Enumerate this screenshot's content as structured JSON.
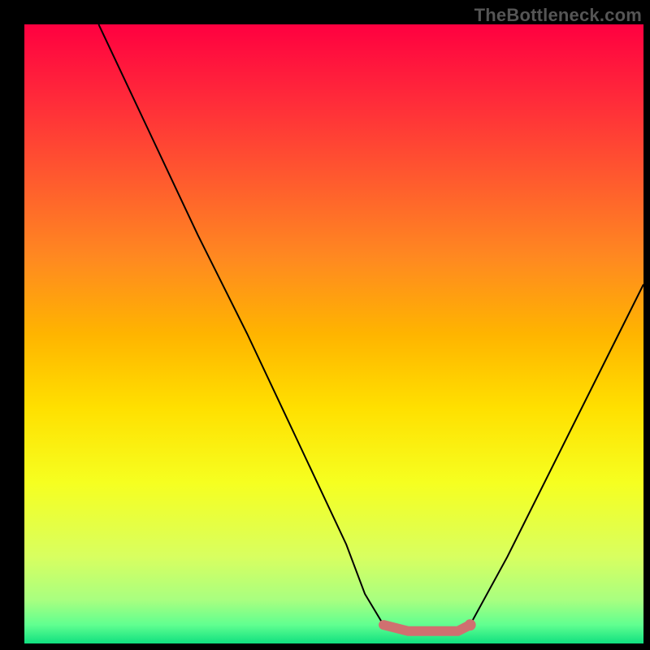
{
  "watermark": "TheBottleneck.com",
  "chart_data": {
    "type": "line",
    "title": "",
    "xlabel": "",
    "ylabel": "",
    "xlim": [
      0,
      100
    ],
    "ylim": [
      0,
      100
    ],
    "series": [
      {
        "name": "left-branch",
        "x": [
          12,
          20,
          28,
          36,
          44,
          52,
          55,
          58
        ],
        "y": [
          100,
          83,
          66,
          50,
          33,
          16,
          8,
          3
        ]
      },
      {
        "name": "plateau",
        "x": [
          58,
          62,
          66,
          70,
          72
        ],
        "y": [
          3,
          2,
          2,
          2,
          3
        ]
      },
      {
        "name": "right-branch",
        "x": [
          72,
          78,
          84,
          90,
          96,
          100
        ],
        "y": [
          3,
          14,
          26,
          38,
          50,
          58
        ]
      }
    ],
    "plateau_marker": {
      "x": 72,
      "y": 3
    },
    "annotations": []
  },
  "gradient": {
    "stops": [
      {
        "offset": 0.0,
        "color": "#ff0040"
      },
      {
        "offset": 0.12,
        "color": "#ff2a3a"
      },
      {
        "offset": 0.25,
        "color": "#ff5a2e"
      },
      {
        "offset": 0.38,
        "color": "#ff8a20"
      },
      {
        "offset": 0.5,
        "color": "#ffb400"
      },
      {
        "offset": 0.62,
        "color": "#ffe000"
      },
      {
        "offset": 0.74,
        "color": "#f6ff20"
      },
      {
        "offset": 0.86,
        "color": "#d8ff60"
      },
      {
        "offset": 0.93,
        "color": "#a8ff80"
      },
      {
        "offset": 0.97,
        "color": "#60ff90"
      },
      {
        "offset": 1.0,
        "color": "#10e080"
      }
    ]
  }
}
